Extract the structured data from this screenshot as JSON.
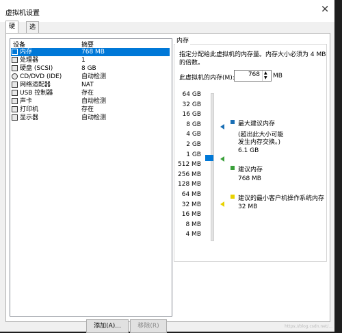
{
  "window": {
    "title": "虚拟机设置",
    "close_icon": "close-icon"
  },
  "tabs": [
    {
      "label": "硬件",
      "active": true
    },
    {
      "label": "选项",
      "active": false
    }
  ],
  "device_list": {
    "col_device": "设备",
    "col_summary": "摘要",
    "items": [
      {
        "name": "内存",
        "summary": "768 MB",
        "icon": "memory-icon",
        "selected": true
      },
      {
        "name": "处理器",
        "summary": "1",
        "icon": "cpu-icon"
      },
      {
        "name": "硬盘 (SCSI)",
        "summary": "8 GB",
        "icon": "disk-icon"
      },
      {
        "name": "CD/DVD (IDE)",
        "summary": "自动检测",
        "icon": "cd-icon"
      },
      {
        "name": "网络适配器",
        "summary": "NAT",
        "icon": "network-icon"
      },
      {
        "name": "USB 控制器",
        "summary": "存在",
        "icon": "usb-icon"
      },
      {
        "name": "声卡",
        "summary": "自动检测",
        "icon": "sound-icon"
      },
      {
        "name": "打印机",
        "summary": "存在",
        "icon": "printer-icon"
      },
      {
        "name": "显示器",
        "summary": "自动检测",
        "icon": "display-icon"
      }
    ]
  },
  "memory": {
    "group_label": "内存",
    "description_line1": "指定分配给此虚拟机的内存量。内存大小必须为 4 MB",
    "description_line2": "的倍数。",
    "field_label": "此虚拟机的内存(M):",
    "value": "768",
    "unit": "MB",
    "scale": [
      "64 GB",
      "32 GB",
      "16 GB",
      "8 GB",
      "4 GB",
      "2 GB",
      "1 GB",
      "512 MB",
      "256 MB",
      "128 MB",
      "64 MB",
      "32 MB",
      "16 MB",
      "8 MB",
      "4 MB"
    ],
    "max_rec_label": "最大建议内存",
    "max_rec_note_line1": "(超出此大小可能",
    "max_rec_note_line2": "发生内存交换。)",
    "max_rec_value": "6.1 GB",
    "rec_label": "建议内存",
    "rec_value": "768 MB",
    "min_rec_label": "建议的最小客户机操作系统内存",
    "min_rec_value": "32 MB",
    "colors": {
      "max": "#1a6fb5",
      "rec": "#3aa03a",
      "min": "#e8d200",
      "thumb": "#0078d7"
    }
  },
  "buttons": {
    "add": "添加(A)...",
    "remove": "移除(R)"
  },
  "watermark": "https://blog.csdn.net/..."
}
